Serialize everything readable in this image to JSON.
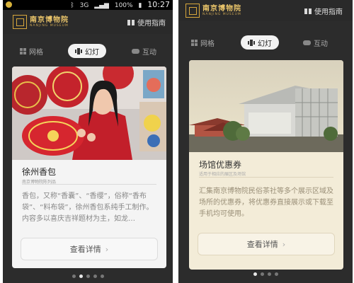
{
  "status_bar": {
    "battery": "100%",
    "network": "3G",
    "time": "10:27"
  },
  "header": {
    "logo_cn": "南京博物院",
    "logo_en": "NANJING MUSEUM",
    "guide_label": "使用指南",
    "accent_color": "#d7a73c"
  },
  "tabs": [
    {
      "label": "网格",
      "icon": "grid-icon"
    },
    {
      "label": "幻灯",
      "icon": "slide-icon",
      "active": true
    },
    {
      "label": "互动",
      "icon": "gamepad-icon"
    }
  ],
  "cards": [
    {
      "title": "徐州香包",
      "subtitle": "南京博物院陈列品",
      "body": "香包，又称“香囊”、“香缨”，俗称“香布袋”、“料布袋”，徐州香包系纯手工制作。内容多以喜庆吉祥题材为主，如龙…",
      "button": "查看详情",
      "page_index": 2,
      "page_count": 5
    },
    {
      "title": "场馆优惠券",
      "subtitle": "适用于相应的展区及场馆",
      "body": "汇集南京博物院民俗茶社等多个展示区域及场所的优惠券，将优惠券直接展示或下载至手机均可使用。",
      "button": "查看详情",
      "page_index": 1,
      "page_count": 4
    }
  ]
}
